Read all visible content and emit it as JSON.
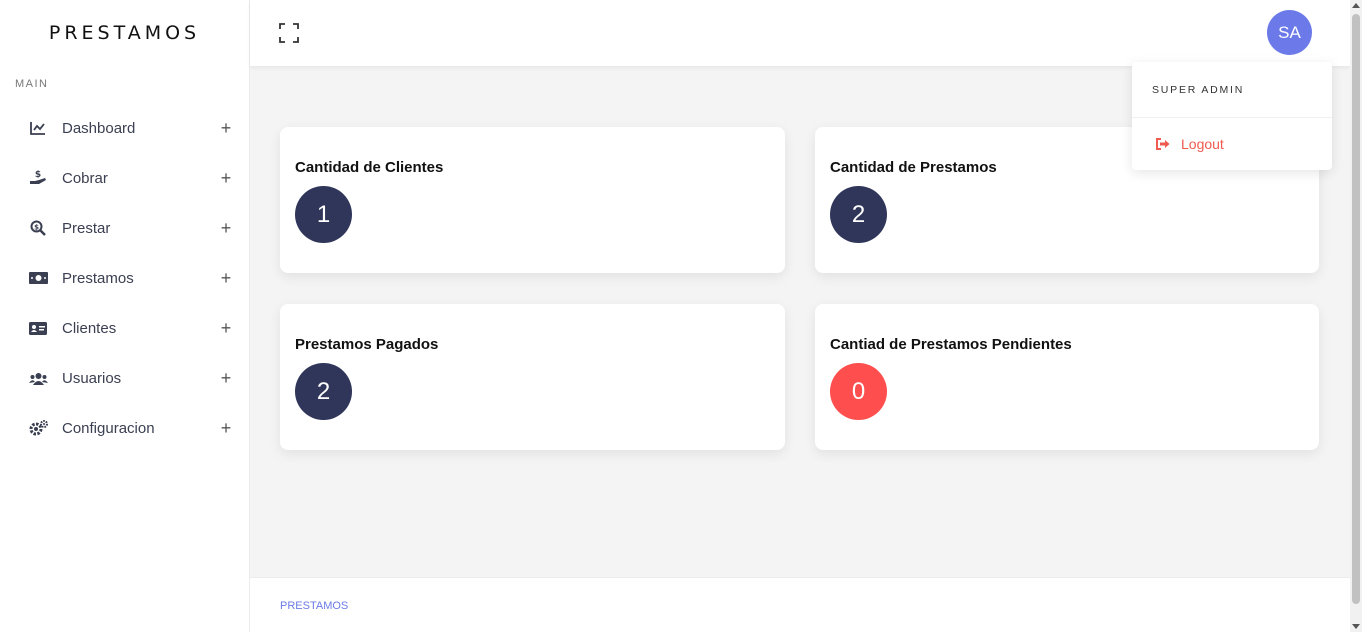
{
  "sidebar": {
    "brand": "PRESTAMOS",
    "section_label": "MAIN",
    "items": [
      {
        "label": "Dashboard",
        "icon": "chart-line-icon"
      },
      {
        "label": "Cobrar",
        "icon": "hand-dollar-icon"
      },
      {
        "label": "Prestar",
        "icon": "search-dollar-icon"
      },
      {
        "label": "Prestamos",
        "icon": "money-bill-icon"
      },
      {
        "label": "Clientes",
        "icon": "id-card-icon"
      },
      {
        "label": "Usuarios",
        "icon": "users-icon"
      },
      {
        "label": "Configuracion",
        "icon": "cogs-icon"
      }
    ],
    "expand_symbol": "+"
  },
  "header": {
    "avatar_initials": "SA"
  },
  "dropdown": {
    "role": "SUPER ADMIN",
    "logout_label": "Logout"
  },
  "cards": [
    {
      "title": "Cantidad de Clientes",
      "value": "1"
    },
    {
      "title": "Cantidad de Prestamos",
      "value": "2"
    },
    {
      "title": "Prestamos Pagados",
      "value": "2"
    },
    {
      "title": "Cantiad de Prestamos Pendientes",
      "value": "0"
    }
  ],
  "footer": {
    "text": "PRESTAMOS"
  },
  "colors": {
    "accent": "#6b7ae8",
    "badge_dark": "#30365a",
    "badge_red": "#ff4e4e",
    "logout_red": "#f05a4f"
  }
}
